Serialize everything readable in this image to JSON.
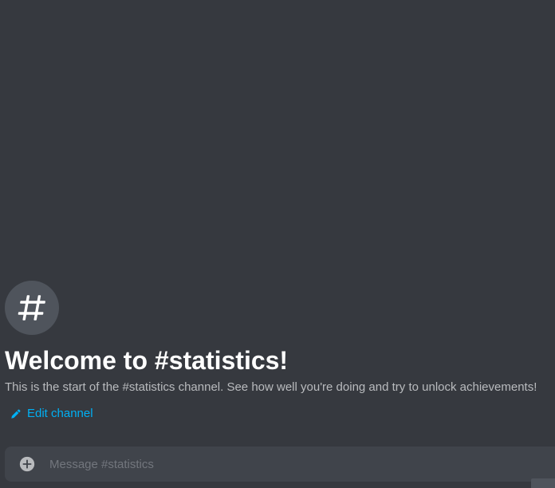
{
  "channel": {
    "name": "statistics",
    "icon": "hash-icon",
    "welcome_title": "Welcome to #statistics!",
    "welcome_description": "This is the start of the #statistics channel. See how well you're doing and try to unlock achievements!",
    "edit_label": "Edit channel"
  },
  "composer": {
    "placeholder": "Message #statistics",
    "value": "",
    "attach_icon": "plus-circle-icon"
  },
  "colors": {
    "background": "#36393f",
    "title": "#ffffff",
    "description": "#b9bbbe",
    "link": "#00b0f4",
    "composer_bg": "#40444b",
    "icon_bg": "#4f545c"
  }
}
